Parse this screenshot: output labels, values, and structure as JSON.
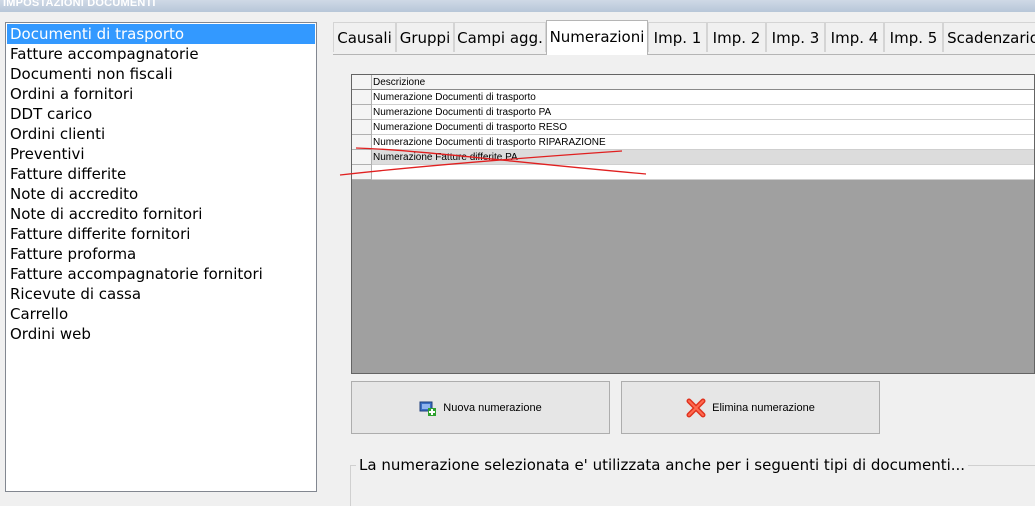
{
  "window": {
    "title": "IMPOSTAZIONI DOCUMENTI"
  },
  "document_types": [
    "Documenti di trasporto",
    "Fatture accompagnatorie",
    "Documenti non fiscali",
    "Ordini a fornitori",
    "DDT carico",
    "Ordini clienti",
    "Preventivi",
    "Fatture differite",
    "Note di accredito",
    "Note di accredito fornitori",
    "Fatture differite fornitori",
    "Fatture proforma",
    "Fatture accompagnatorie fornitori",
    "Ricevute di cassa",
    "Carrello",
    "Ordini web"
  ],
  "selected_document_type": "Documenti di trasporto",
  "tabs": [
    "Causali",
    "Gruppi",
    "Campi agg.",
    "Numerazioni",
    "Imp. 1",
    "Imp. 2",
    "Imp. 3",
    "Imp. 4",
    "Imp. 5",
    "Scadenzario"
  ],
  "active_tab": "Numerazioni",
  "grid": {
    "column_header": "Descrizione",
    "rows": [
      "Numerazione Documenti di trasporto",
      "Numerazione Documenti di trasporto PA",
      "Numerazione Documenti di trasporto RESO",
      "Numerazione Documenti di trasporto RIPARAZIONE",
      "Numerazione Fatture differite PA",
      ""
    ],
    "selected_row": "Numerazione Fatture differite PA"
  },
  "buttons": {
    "new_label": "Nuova numerazione",
    "new_icon": "add-numbering-icon",
    "delete_label": "Elimina numerazione",
    "delete_icon": "red-x-icon"
  },
  "usage_group": {
    "label": "La numerazione selezionata e' utilizzata anche per i seguenti tipi di documenti..."
  },
  "colors": {
    "selection": "#3399ff",
    "grid_background": "#a0a0a0",
    "annotation_strokes": "#e02020"
  }
}
